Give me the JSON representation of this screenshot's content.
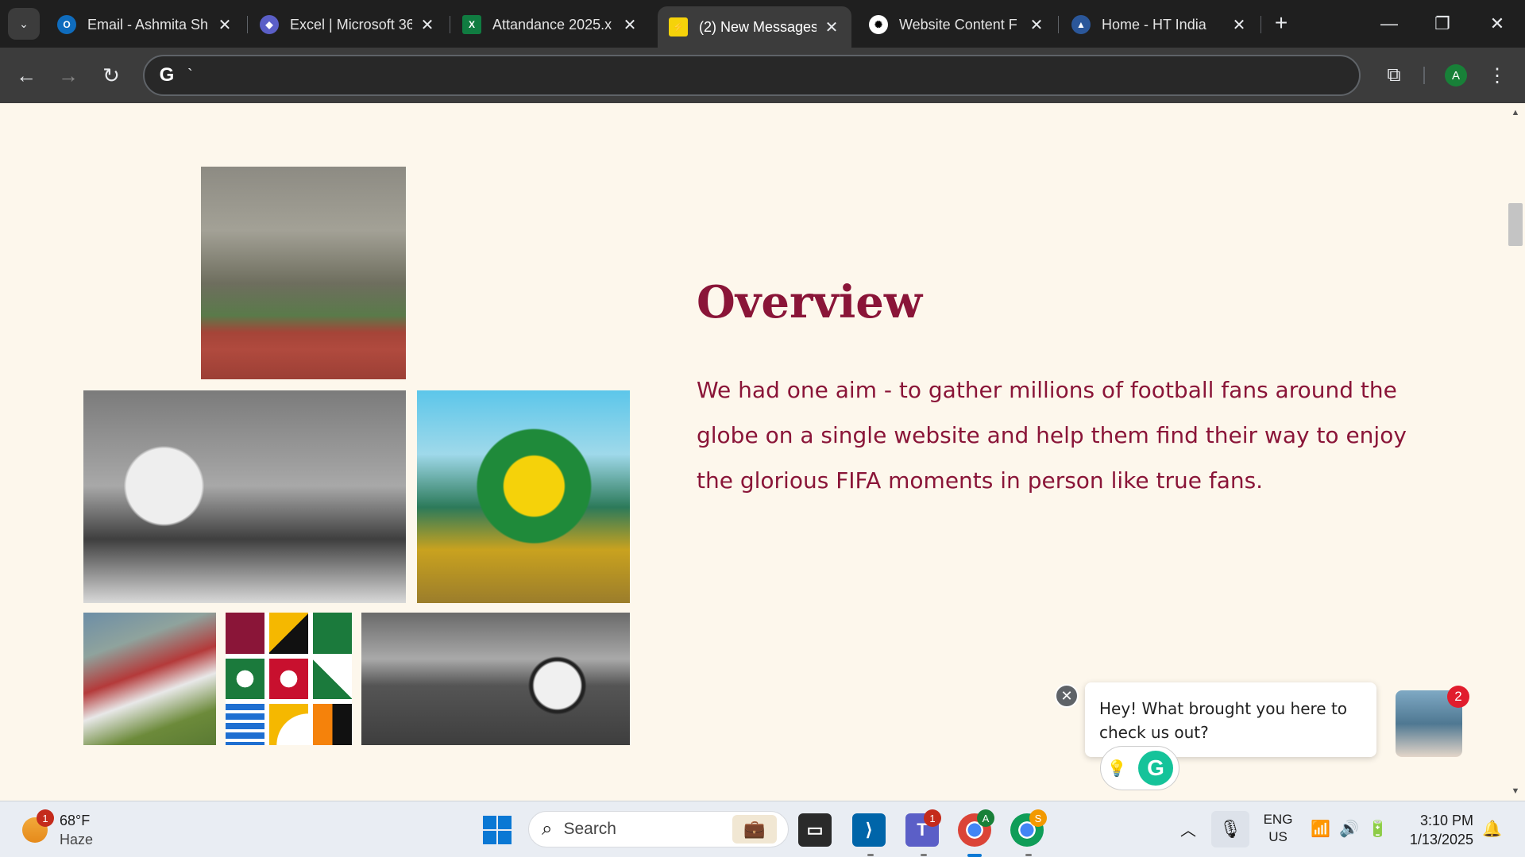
{
  "browser": {
    "tabs": [
      {
        "title": "Email - Ashmita Sh",
        "icon": "outlook-icon",
        "color": "#0f6cbd",
        "active": false
      },
      {
        "title": "Excel | Microsoft 36",
        "icon": "copilot-icon",
        "color": "#5b5fc7",
        "active": false
      },
      {
        "title": "Attandance 2025.x",
        "icon": "excel-icon",
        "color": "#107c41",
        "active": false
      },
      {
        "title": "(2) New Messages!",
        "icon": "brand-icon",
        "color": "#f5d20a",
        "active": true
      },
      {
        "title": "Website Content F",
        "icon": "chatgpt-icon",
        "color": "#ffffff",
        "active": false
      },
      {
        "title": "Home - HT India",
        "icon": "ht-icon",
        "color": "#2b579a",
        "active": false
      }
    ],
    "address_value": "`",
    "profile_initial": "A"
  },
  "page": {
    "overview_title": "Overview",
    "overview_text": "We had one aim - to gather millions of football fans around the globe on a single website and help them find their way to enjoy the glorious FIFA moments in person like true fans.",
    "chat_message": "Hey! What brought you here to check us out?",
    "chat_badge": "2",
    "accent_color": "#8a1538"
  },
  "taskbar": {
    "weather_temp": "68°F",
    "weather_desc": "Haze",
    "weather_badge": "1",
    "search_placeholder": "Search",
    "teams_badge": "1",
    "chrome_profile_badge": "A",
    "chrome2_badge": "S",
    "lang_top": "ENG",
    "lang_bottom": "US",
    "time": "3:10 PM",
    "date": "1/13/2025"
  }
}
